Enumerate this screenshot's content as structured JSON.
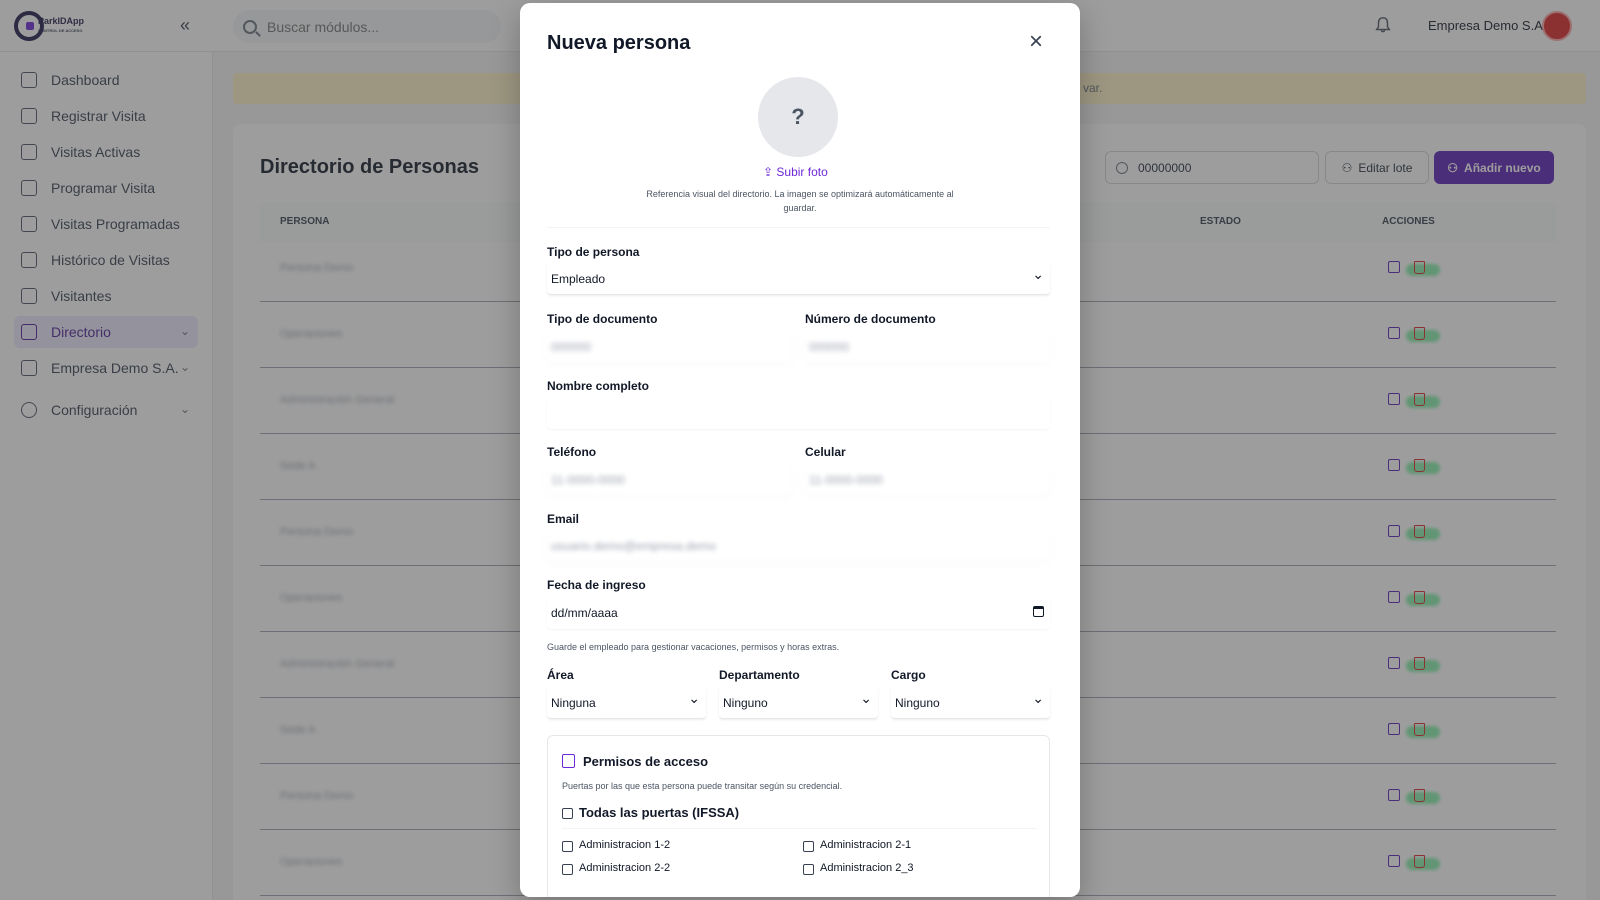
{
  "topbar": {
    "logo_text": "ParkIDApp",
    "logo_sub": "CONTROL DE ACCESO",
    "search_placeholder": "Buscar módulos...",
    "company": "Empresa Demo S.A."
  },
  "sidebar": {
    "items": [
      {
        "label": "Dashboard",
        "icon": "home-icon"
      },
      {
        "label": "Registrar Visita",
        "icon": "user-plus-icon"
      },
      {
        "label": "Visitas Activas",
        "icon": "list-check-icon"
      },
      {
        "label": "Programar Visita",
        "icon": "calendar-icon"
      },
      {
        "label": "Visitas Programadas",
        "icon": "calendar-clock-icon"
      },
      {
        "label": "Histórico de Visitas",
        "icon": "history-icon"
      },
      {
        "label": "Visitantes",
        "icon": "users-icon"
      },
      {
        "label": "Directorio",
        "icon": "book-user-icon",
        "active": true
      },
      {
        "label": "Empresa Demo S.A.",
        "icon": "document-icon"
      },
      {
        "label": "Configuración",
        "icon": "gear-icon"
      }
    ]
  },
  "banner": {
    "text": "var."
  },
  "directory": {
    "title": "Directorio de Personas",
    "search_value": "00000000",
    "edit_batch_label": "Editar lote",
    "add_new_label": "Añadir nuevo",
    "columns": {
      "persona": "PERSONA",
      "estado": "ESTADO",
      "acciones": "ACCIONES"
    }
  },
  "modal": {
    "title": "Nueva persona",
    "photo_placeholder": "?",
    "upload_label": "Subir foto",
    "photo_help": "Referencia visual del directorio. La imagen se optimizará automáticamente al guardar.",
    "tipo_persona_label": "Tipo de persona",
    "tipo_persona_value": "Empleado",
    "tipo_doc_label": "Tipo de documento",
    "numero_doc_label": "Número de documento",
    "nombre_label": "Nombre completo",
    "telefono_label": "Teléfono",
    "celular_label": "Celular",
    "email_label": "Email",
    "fecha_label": "Fecha de ingreso",
    "fecha_placeholder": "dd/mm/aaaa",
    "empleado_help": "Guarde el empleado para gestionar vacaciones, permisos y horas extras.",
    "area_label": "Área",
    "area_value": "Ninguna",
    "departamento_label": "Departamento",
    "departamento_value": "Ninguno",
    "cargo_label": "Cargo",
    "cargo_value": "Ninguno",
    "permisos": {
      "title": "Permisos de acceso",
      "help": "Puertas por las que esta persona puede transitar según su credencial.",
      "all_doors": "Todas las puertas (IFSSA)",
      "doors": [
        "Administracion 1-2",
        "Administracion 2-1",
        "Administracion 2-2",
        "Administracion 2_3"
      ]
    }
  },
  "colors": {
    "accent": "#5b21b6",
    "danger": "#dc2626",
    "success": "#86efac"
  }
}
